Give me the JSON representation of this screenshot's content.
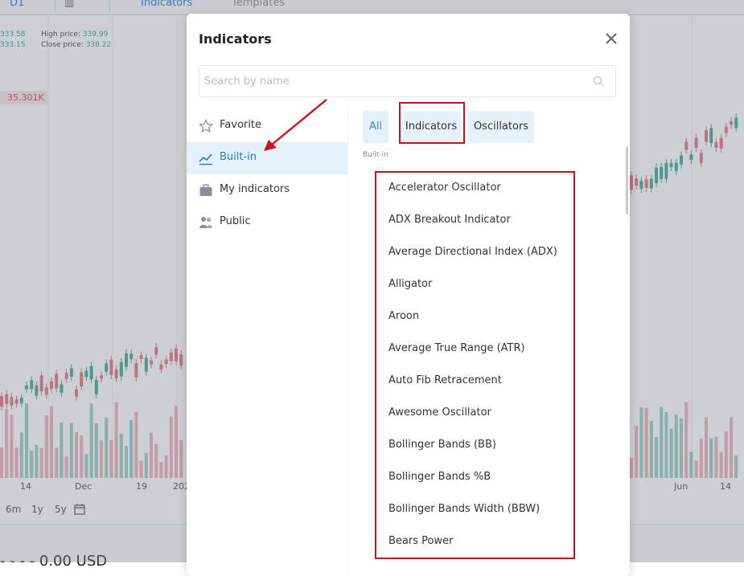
{
  "background": {
    "toolbar": {
      "interval": "D1",
      "indicators_label": "Indicators",
      "templates_label": "Templates"
    },
    "ohlc": {
      "open_value": "333.58",
      "high_label": "High price:",
      "high_value": "339.99",
      "low_value": "333.15",
      "close_label": "Close price:",
      "close_value": "338.22"
    },
    "price_tag": "35.301K",
    "axis_labels": [
      "14",
      "Dec",
      "19",
      "202",
      "Jun",
      "14"
    ],
    "ranges": [
      "6m",
      "1y",
      "5y"
    ],
    "bottom_text": "- - - - 0.00 USD",
    "colors": {
      "up": "#3aa58f",
      "down": "#e26c7d"
    }
  },
  "modal": {
    "title": "Indicators",
    "search": {
      "placeholder": "Search by name",
      "value": ""
    },
    "sidebar": [
      {
        "label": "Favorite",
        "icon": "star-icon"
      },
      {
        "label": "Built-in",
        "icon": "chart-line-icon"
      },
      {
        "label": "My indicators",
        "icon": "briefcase-icon"
      },
      {
        "label": "Public",
        "icon": "users-icon"
      }
    ],
    "active_sidebar": "Built-in",
    "tabs": [
      "All",
      "Indicators",
      "Oscillators"
    ],
    "active_tab": "All",
    "section_label": "Built-in",
    "indicators": [
      "Accelerator Oscillator",
      "ADX Breakout Indicator",
      "Average Directional Index (ADX)",
      "Alligator",
      "Aroon",
      "Average True Range (ATR)",
      "Auto Fib Retracement",
      "Awesome Oscillator",
      "Bollinger Bands (BB)",
      "Bollinger Bands %B",
      "Bollinger Bands Width (BBW)",
      "Bears Power"
    ],
    "accent_color": "#2b7bc4",
    "annotation_color": "#c8101e"
  }
}
